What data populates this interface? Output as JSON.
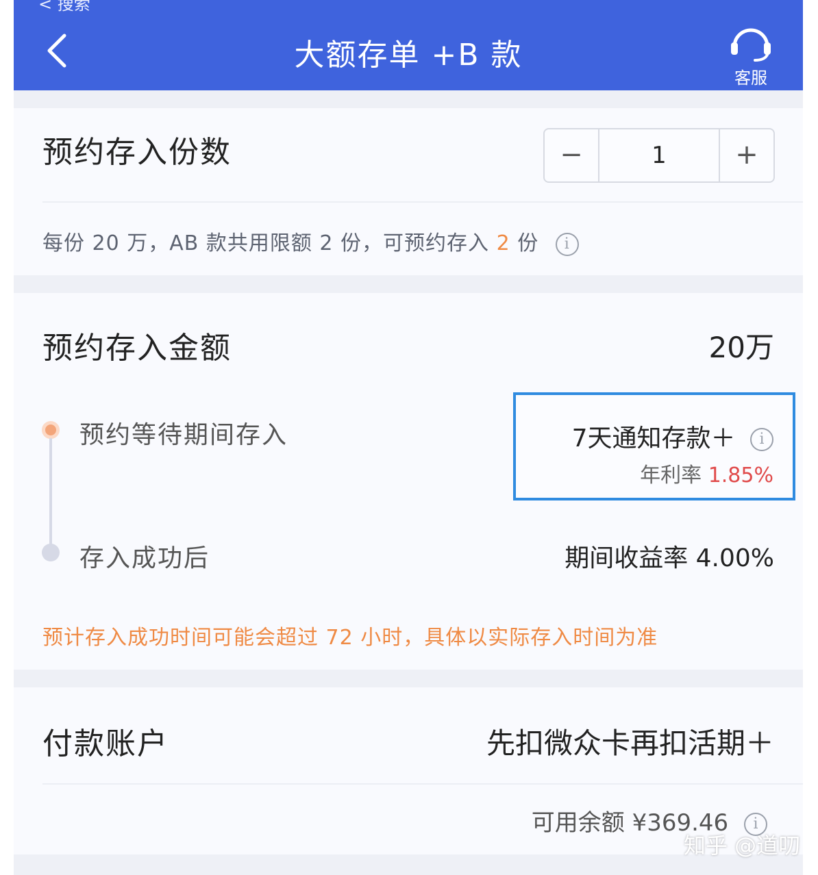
{
  "header": {
    "back_crumb": "< 搜索",
    "title": "大额存单 +B 款",
    "support_label": "客服"
  },
  "shares": {
    "label": "预约存入份数",
    "stepper_minus": "−",
    "stepper_value": "1",
    "stepper_plus": "+",
    "hint_prefix": "每份 20 万，AB 款共用限额 2 份，可预约存入 ",
    "hint_highlight": "2",
    "hint_suffix": " 份"
  },
  "amount": {
    "label": "预约存入金额",
    "value": "20万",
    "waiting_label": "预约等待期间存入",
    "waiting_product": "7天通知存款＋",
    "waiting_rate_label": "年利率 ",
    "waiting_rate_value": "1.85%",
    "after_label": "存入成功后",
    "after_rate": "期间收益率 4.00%",
    "warning": "预计存入成功时间可能会超过 72 小时，具体以实际存入时间为准"
  },
  "payment": {
    "label": "付款账户",
    "value": "先扣微众卡再扣活期＋",
    "balance": "可用余额 ¥369.46"
  },
  "icons": {
    "info": "i"
  },
  "watermark": "知乎 @道叨",
  "colors": {
    "header_bg": "#3f63dd",
    "accent_orange": "#ef8a44",
    "rate_red": "#e04a4a",
    "highlight_border": "#2f8be0"
  }
}
